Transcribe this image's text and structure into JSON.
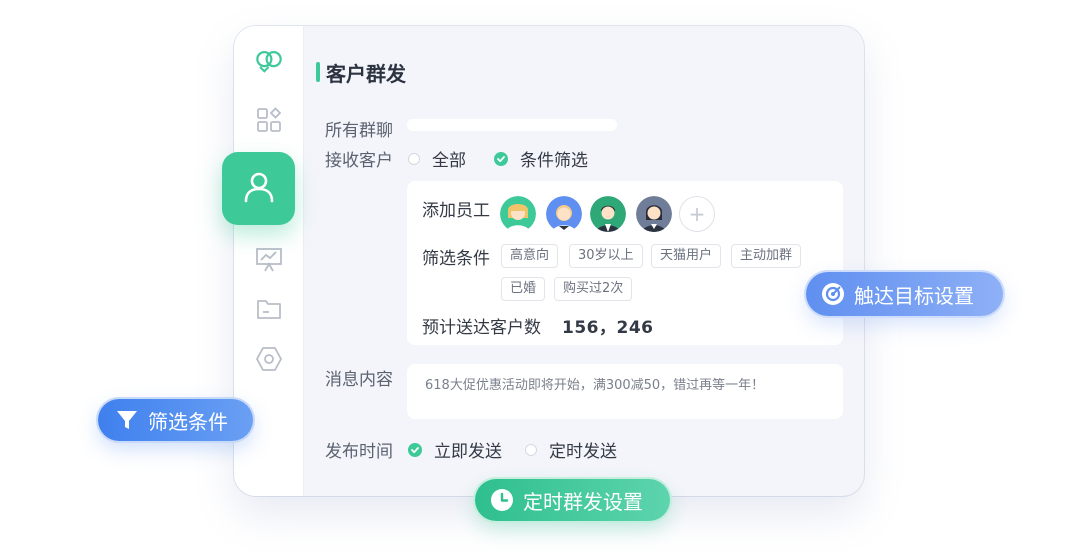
{
  "app": {
    "page_title": "客户群发"
  },
  "sidebar": {
    "items": [
      {
        "icon": "logo-icon"
      },
      {
        "icon": "apps-grid-icon"
      },
      {
        "icon": "user-icon",
        "active": true
      },
      {
        "icon": "chart-board-icon"
      },
      {
        "icon": "folder-icon"
      },
      {
        "icon": "hexagon-settings-icon"
      }
    ]
  },
  "form": {
    "all_groups_label": "所有群聊",
    "receiver_label": "接收客户",
    "receiver_options": [
      {
        "label": "全部",
        "checked": false
      },
      {
        "label": "条件筛选",
        "checked": true
      }
    ],
    "add_staff_label": "添加员工",
    "filter_label": "筛选条件",
    "tags": [
      "高意向",
      "30岁以上",
      "天猫用户",
      "主动加群",
      "已婚",
      "购买过2次"
    ],
    "estimate_label": "预计送达客户数",
    "estimate_value": "156，246",
    "message_label": "消息内容",
    "message_text": "618大促优惠活动即将开始，满300减50，错过再等一年！",
    "publish_label": "发布时间",
    "publish_options": [
      {
        "label": "立即发送",
        "checked": true
      },
      {
        "label": "定时发送",
        "checked": false
      }
    ],
    "add_symbol": "+"
  },
  "badges": {
    "target": "触达目标设置",
    "filter": "筛选条件",
    "timer": "定时群发设置"
  },
  "colors": {
    "accent_green": "#3ec999",
    "accent_blue": "#5f8ff0",
    "card_bg": "#f4f5fa"
  }
}
